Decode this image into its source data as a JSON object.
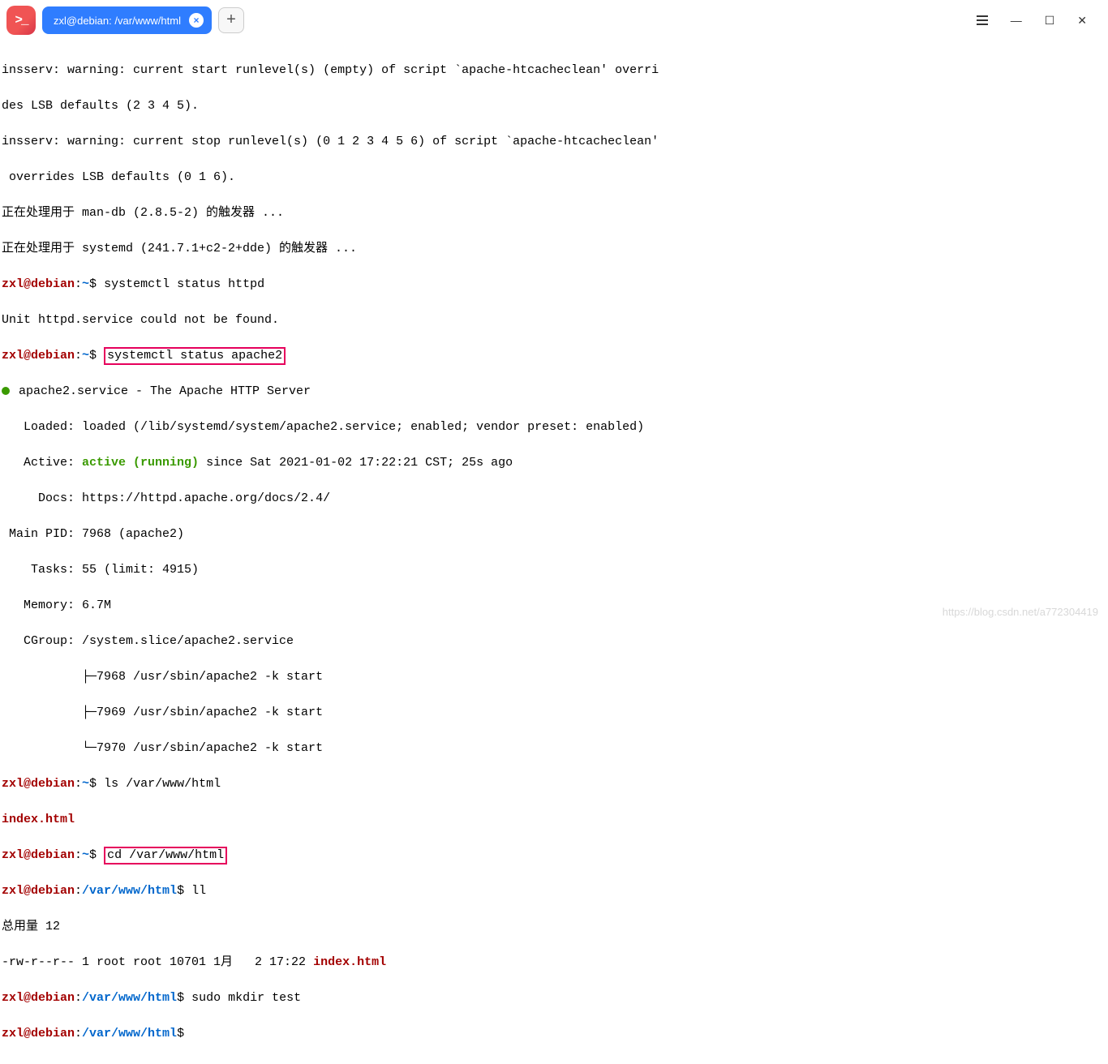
{
  "titlebar": {
    "tab_title": "zxl@debian: /var/www/html",
    "tab_close_glyph": "×",
    "new_tab_glyph": "+",
    "minimize_glyph": "—",
    "maximize_glyph": "☐",
    "close_glyph": "✕"
  },
  "prompt": {
    "user_host": "zxl@debian",
    "sep": ":",
    "home": "~",
    "docroot": "/var/www/html",
    "dollar": "$"
  },
  "lines": {
    "l1": "insserv: warning: current start runlevel(s) (empty) of script `apache-htcacheclean' overri",
    "l2": "des LSB defaults (2 3 4 5).",
    "l3": "insserv: warning: current stop runlevel(s) (0 1 2 3 4 5 6) of script `apache-htcacheclean'",
    "l4": " overrides LSB defaults (0 1 6).",
    "l5": "正在处理用于 man-db (2.8.5-2) 的触发器 ...",
    "l6": "正在处理用于 systemd (241.7.1+c2-2+dde) 的触发器 ...",
    "cmd1": " systemctl status httpd",
    "out1": "Unit httpd.service could not be found.",
    "cmd2_pre": " ",
    "cmd2_hl": "systemctl status apache2",
    "svc_line": " apache2.service - The Apache HTTP Server",
    "loaded": "   Loaded: loaded (/lib/systemd/system/apache2.service; enabled; vendor preset: enabled)",
    "active_pre": "   Active: ",
    "active_green": "active (running)",
    "active_post": " since Sat 2021-01-02 17:22:21 CST; 25s ago",
    "docs": "     Docs: https://httpd.apache.org/docs/2.4/",
    "mainpid": " Main PID: 7968 (apache2)",
    "tasks": "    Tasks: 55 (limit: 4915)",
    "memory": "   Memory: 6.7M",
    "cgroup": "   CGroup: /system.slice/apache2.service",
    "tree1": "           ├─7968 /usr/sbin/apache2 -k start",
    "tree2": "           ├─7969 /usr/sbin/apache2 -k start",
    "tree3": "           └─7970 /usr/sbin/apache2 -k start",
    "cmd3": " ls /var/www/html",
    "index": "index.html",
    "cmd4_hl": "cd /var/www/html",
    "cmd5": " ll",
    "total": "总用量 12",
    "lsrow_pre": "-rw-r--r-- 1 root root 10701 1月   2 17:22 ",
    "cmd6": " sudo mkdir test",
    "cursor": " "
  },
  "watermark": "https://blog.csdn.net/a772304419"
}
